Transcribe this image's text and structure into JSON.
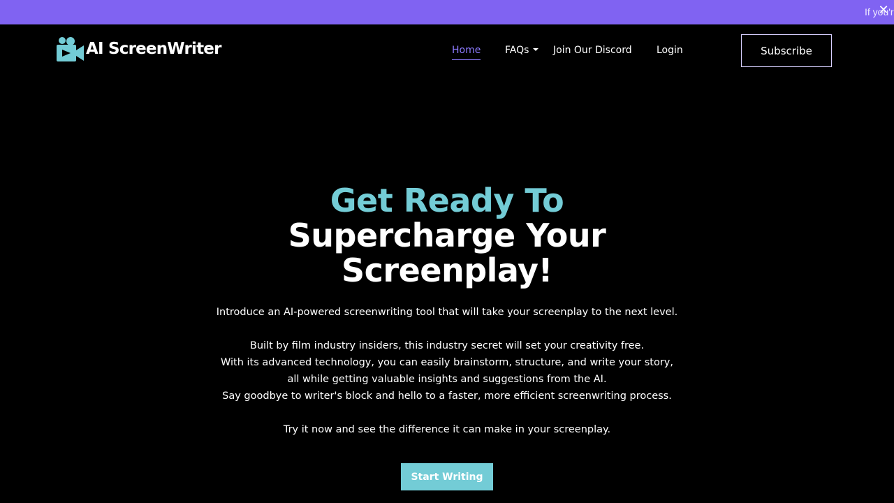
{
  "banner": {
    "text": "If you'r",
    "close_glyph": "✕"
  },
  "brand": {
    "ai": "AI",
    "screenwriter": "ScreenWriter",
    "icon": "movie-camera-icon",
    "accent": "#73ccd6"
  },
  "nav": {
    "home": "Home",
    "faqs": "FAQs",
    "discord": "Join Our Discord",
    "login": "Login",
    "active_color": "#8d7bff"
  },
  "header": {
    "subscribe": "Subscribe"
  },
  "hero": {
    "line1": "Get Ready To",
    "line2": "Supercharge Your",
    "line3": "Screenplay!",
    "intro": "Introduce an AI-powered screenwriting tool that will take your screenplay to the next level.",
    "p1": "Built by film industry insiders, this industry secret will set your creativity free.",
    "p2": "With its advanced technology, you can easily brainstorm, structure, and write your story,",
    "p3": "all while getting valuable insights and suggestions from the AI.",
    "p4": "Say goodbye to writer's block and hello to a faster, more efficient screenwriting process.",
    "p5": "Try it now and see the difference it can make in your screenplay.",
    "cta": "Start Writing"
  },
  "colors": {
    "banner": "#8063f2",
    "background": "#000000",
    "accent": "#73ccd6"
  }
}
